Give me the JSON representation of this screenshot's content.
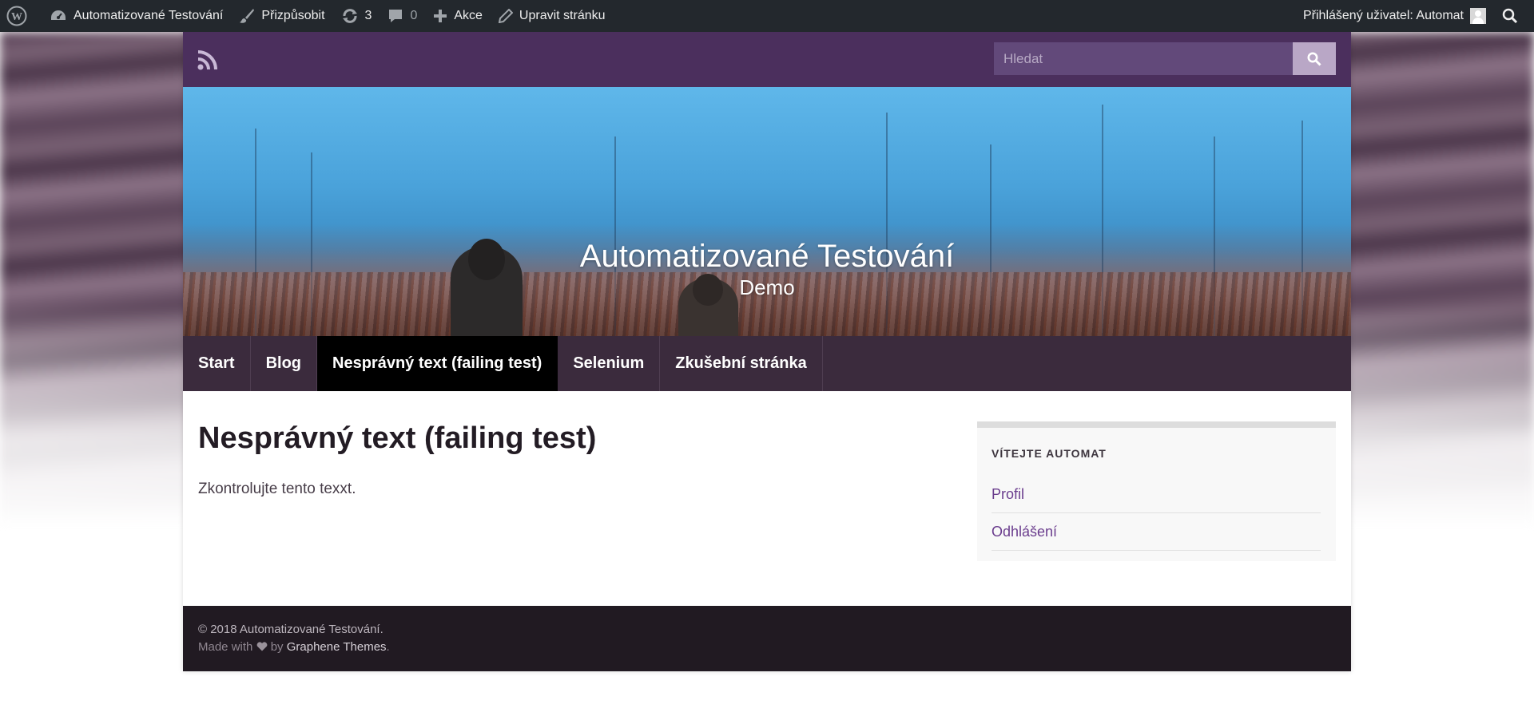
{
  "adminbar": {
    "site_name": "Automatizované Testování",
    "customize": "Přizpůsobit",
    "updates_count": "3",
    "comments_count": "0",
    "new": "Akce",
    "edit_page": "Upravit stránku",
    "logged_in_as": "Přihlášený uživatel: Automat"
  },
  "header": {
    "search_placeholder": "Hledat",
    "site_title": "Automatizované Testování",
    "site_description": "Demo"
  },
  "nav": {
    "items": [
      {
        "label": "Start"
      },
      {
        "label": "Blog"
      },
      {
        "label": "Nesprávný text (failing test)"
      },
      {
        "label": "Selenium"
      },
      {
        "label": "Zkušební stránka"
      }
    ],
    "active_index": 2
  },
  "main": {
    "title": "Nesprávný text (failing test)",
    "text": "Zkontrolujte tento texxt."
  },
  "sidebar": {
    "widget_title": "VÍTEJTE AUTOMAT",
    "links": [
      {
        "label": "Profil"
      },
      {
        "label": "Odhlášení"
      }
    ]
  },
  "footer": {
    "copyright": "© 2018 Automatizované Testování.",
    "made_with": "Made with",
    "by": "by",
    "theme_link": "Graphene Themes",
    "end": "."
  },
  "colors": {
    "admin_bar": "#23282d",
    "topbar": "#4b2f5d",
    "nav": "#3b2b3d",
    "nav_active": "#000000",
    "link": "#6a3c8d",
    "footer": "#211a22"
  },
  "icons": [
    "wordpress-icon",
    "dashboard-icon",
    "brush-icon",
    "updates-icon",
    "comment-icon",
    "plus-icon",
    "pencil-icon",
    "search-icon",
    "rss-icon",
    "heart-icon"
  ]
}
